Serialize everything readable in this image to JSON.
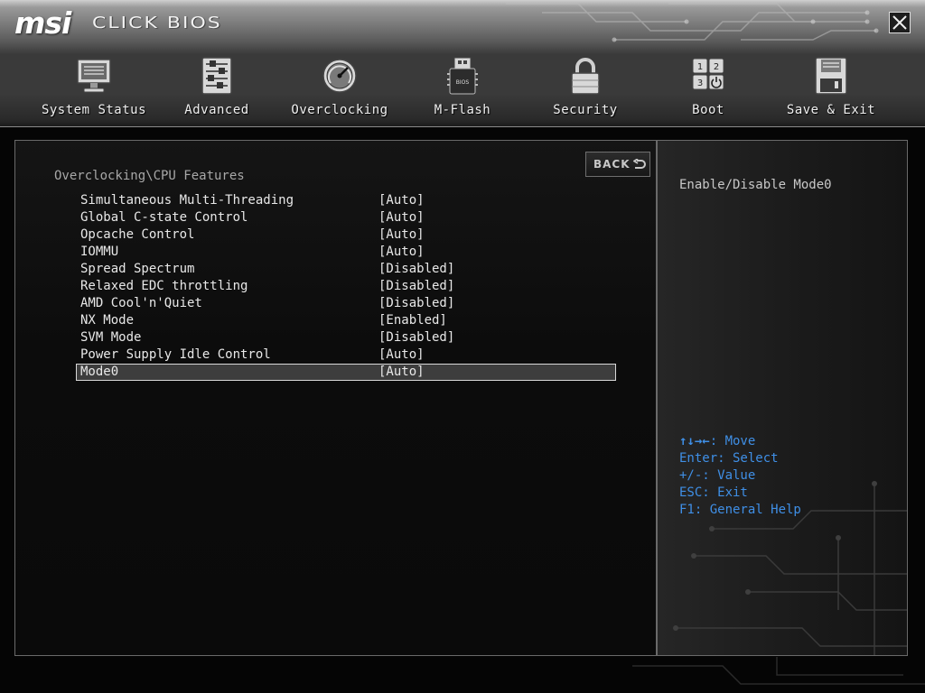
{
  "brand": {
    "logo": "msi",
    "product": "CLICK BIOS"
  },
  "window": {
    "close_icon": "close-icon"
  },
  "nav": [
    {
      "label": "System Status",
      "icon": "monitor-icon"
    },
    {
      "label": "Advanced",
      "icon": "sliders-icon"
    },
    {
      "label": "Overclocking",
      "icon": "gauge-icon"
    },
    {
      "label": "M-Flash",
      "icon": "usb-drive-icon"
    },
    {
      "label": "Security",
      "icon": "lock-icon"
    },
    {
      "label": "Boot",
      "icon": "boot-order-icon"
    },
    {
      "label": "Save & Exit",
      "icon": "floppy-disk-icon"
    }
  ],
  "main": {
    "breadcrumb": "Overclocking\\CPU Features",
    "back_label": "BACK",
    "settings": [
      {
        "label": "Simultaneous Multi-Threading",
        "value": "[Auto]"
      },
      {
        "label": "Global C-state Control",
        "value": "[Auto]"
      },
      {
        "label": "Opcache Control",
        "value": "[Auto]"
      },
      {
        "label": "IOMMU",
        "value": "[Auto]"
      },
      {
        "label": "Spread Spectrum",
        "value": "[Disabled]"
      },
      {
        "label": "Relaxed EDC throttling",
        "value": "[Disabled]"
      },
      {
        "label": "AMD Cool'n'Quiet",
        "value": "[Disabled]"
      },
      {
        "label": "NX Mode",
        "value": "[Enabled]"
      },
      {
        "label": "SVM Mode",
        "value": "[Disabled]"
      },
      {
        "label": "Power Supply Idle Control",
        "value": "[Auto]"
      },
      {
        "label": "Mode0",
        "value": "[Auto]"
      }
    ],
    "selected_index": 10
  },
  "help": {
    "description": "Enable/Disable Mode0",
    "move_arrows": "↑↓→←",
    "move_text": ": Move",
    "keys": [
      "Enter: Select",
      "+/-: Value",
      "ESC: Exit",
      "F1: General Help"
    ]
  },
  "colors": {
    "accent_blue": "#3f8fe6",
    "selection_bg": "#3d3d3d"
  }
}
